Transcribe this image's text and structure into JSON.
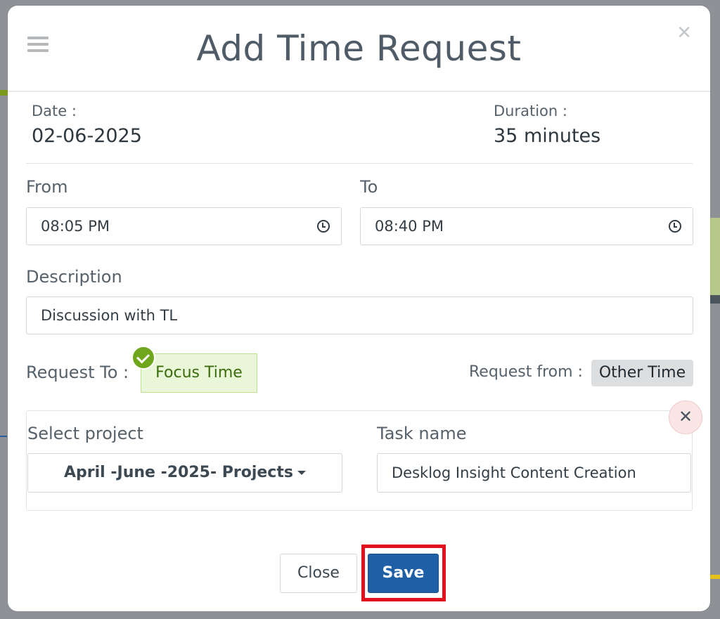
{
  "dialog": {
    "title": "Add Time Request"
  },
  "meta": {
    "date_label": "Date :",
    "date_value": "02-06-2025",
    "duration_label": "Duration :",
    "duration_value": "35 minutes"
  },
  "form": {
    "from_label": "From",
    "from_value": "08:05 PM",
    "to_label": "To",
    "to_value": "08:40 PM",
    "description_label": "Description",
    "description_value": "Discussion with TL",
    "request_to_label": "Request To :",
    "request_to_value": "Focus Time",
    "request_from_label": "Request from :",
    "request_from_value": "Other Time",
    "project_label": "Select project",
    "project_value": "April -June -2025- Projects",
    "task_label": "Task name",
    "task_value": "Desklog Insight Content Creation"
  },
  "actions": {
    "close_label": "Close",
    "save_label": "Save"
  },
  "colors": {
    "accent": "#1f5fa6",
    "focus_green": "#6fa61b",
    "highlight_red": "#e0101c"
  }
}
